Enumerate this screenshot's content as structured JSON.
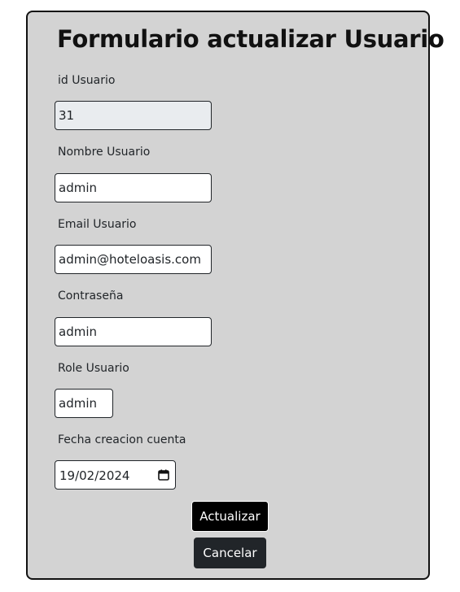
{
  "form": {
    "title": "Formulario actualizar Usuario",
    "fields": {
      "id": {
        "label": "id Usuario",
        "value": "31"
      },
      "nombre": {
        "label": "Nombre Usuario",
        "value": "admin"
      },
      "email": {
        "label": "Email Usuario",
        "value": "admin@hoteloasis.com"
      },
      "password": {
        "label": "Contraseña",
        "value": "admin"
      },
      "role": {
        "label": "Role Usuario",
        "value": "admin"
      },
      "fecha": {
        "label": "Fecha creacion cuenta",
        "value": "19/02/2024",
        "icon": "calendar-icon"
      }
    },
    "buttons": {
      "actualizar": "Actualizar",
      "cancelar": "Cancelar"
    }
  }
}
